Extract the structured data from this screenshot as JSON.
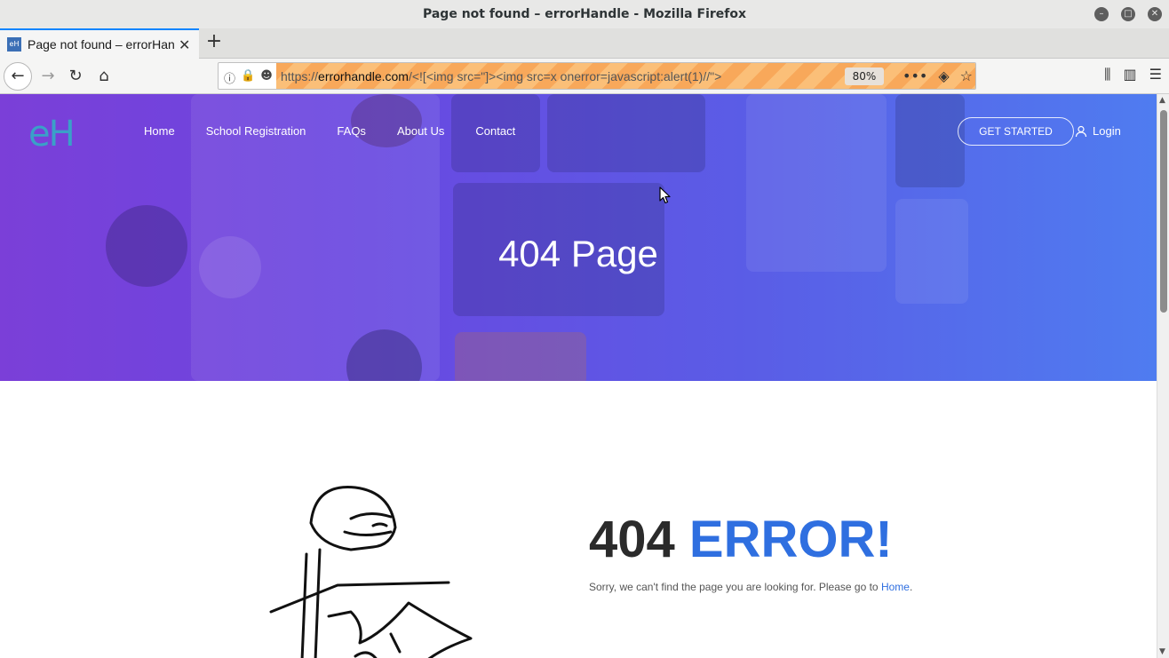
{
  "window": {
    "title": "Page not found – errorHandle - Mozilla Firefox"
  },
  "tab": {
    "title": "Page not found – errorHandle",
    "favicon_text": "eH"
  },
  "urlbar": {
    "scheme": "https://",
    "host": "errorhandle.com",
    "path": "/<![<img src=\"]><img src=x onerror=javascript:alert(1)//\">",
    "zoom": "80%"
  },
  "site": {
    "logo": "eH",
    "nav": [
      "Home",
      "School Registration",
      "FAQs",
      "About Us",
      "Contact"
    ],
    "get_started": "GET STARTED",
    "login": "Login",
    "hero_title": "404 Page"
  },
  "error": {
    "code": "404",
    "word": "ERROR!",
    "message_prefix": "Sorry, we can't find the page you are looking for. Please go to ",
    "home_link": "Home",
    "message_suffix": "."
  },
  "colors": {
    "accent": "#2f6fe0",
    "hero_start": "#7b3fd8",
    "hero_end": "#4f7cf0",
    "urlbar_warning": "#f8a85a"
  }
}
